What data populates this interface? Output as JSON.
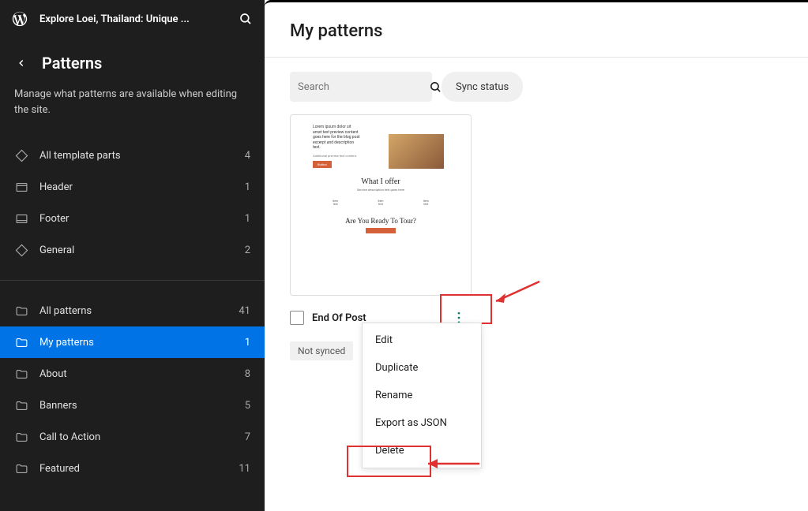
{
  "top": {
    "site_title": "Explore Loei, Thailand: Unique ..."
  },
  "section": {
    "title": "Patterns",
    "description": "Manage what patterns are available when editing the site."
  },
  "nav_template": [
    {
      "label": "All template parts",
      "count": "4"
    },
    {
      "label": "Header",
      "count": "1"
    },
    {
      "label": "Footer",
      "count": "1"
    },
    {
      "label": "General",
      "count": "2"
    }
  ],
  "nav_patterns": [
    {
      "label": "All patterns",
      "count": "41"
    },
    {
      "label": "My patterns",
      "count": "1"
    },
    {
      "label": "About",
      "count": "8"
    },
    {
      "label": "Banners",
      "count": "5"
    },
    {
      "label": "Call to Action",
      "count": "7"
    },
    {
      "label": "Featured",
      "count": "11"
    }
  ],
  "main": {
    "title": "My patterns",
    "search_placeholder": "Search",
    "sync_status": "Sync status"
  },
  "pattern": {
    "name": "End Of Post",
    "sync_tag": "Not synced"
  },
  "preview": {
    "heading1": "What I offer",
    "heading2": "Are You Ready To Tour?"
  },
  "dropdown": {
    "items": [
      "Edit",
      "Duplicate",
      "Rename",
      "Export as JSON",
      "Delete"
    ]
  }
}
